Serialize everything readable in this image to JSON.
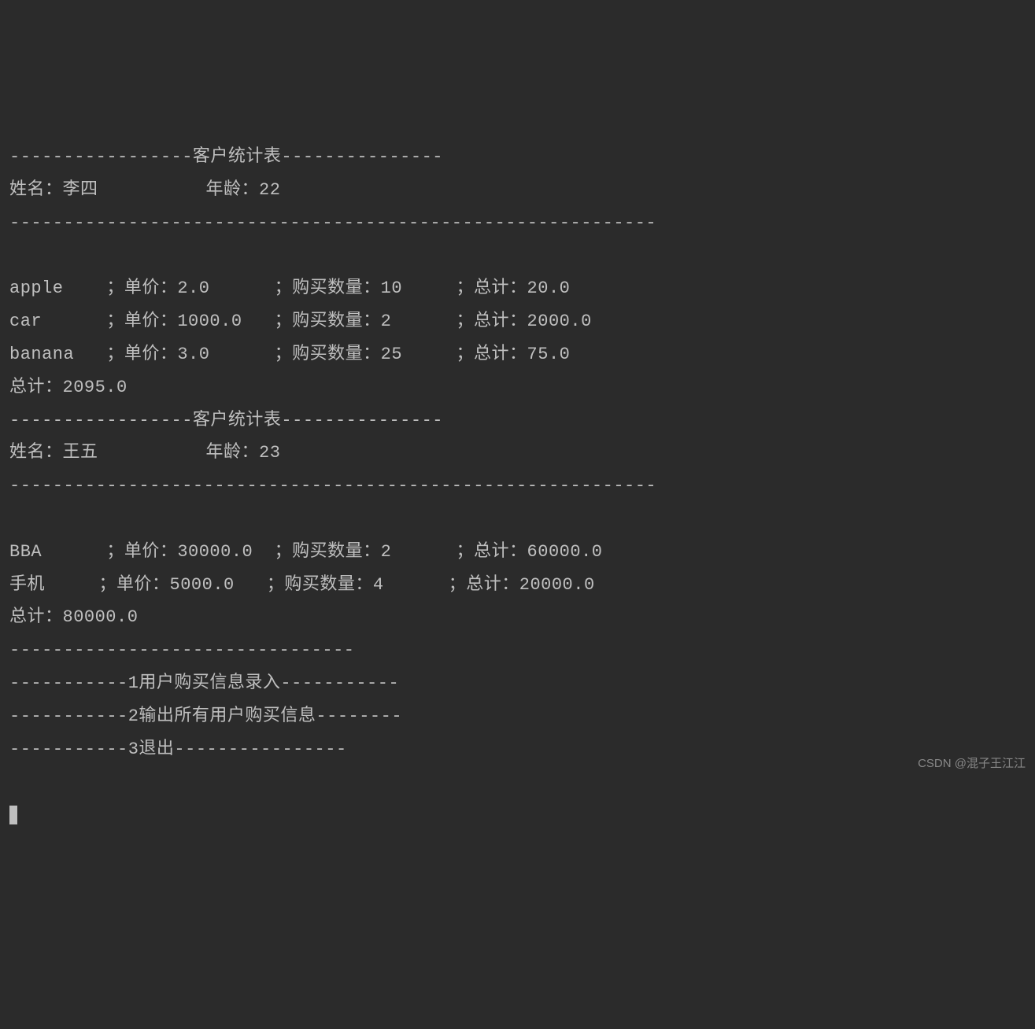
{
  "customers": [
    {
      "header": "-----------------客户统计表---------------",
      "name_label": "姓名：",
      "name": "李四",
      "age_label": "年龄：",
      "age": "22",
      "divider": "------------------------------------------------------------",
      "items": [
        {
          "name": "apple",
          "price_label": "；单价：",
          "price": "2.0",
          "qty_label": "；购买数量：",
          "qty": "10",
          "total_label": "；总计：",
          "total": "20.0"
        },
        {
          "name": "car",
          "price_label": "；单价：",
          "price": "1000.0",
          "qty_label": "；购买数量：",
          "qty": "2",
          "total_label": "；总计：",
          "total": "2000.0"
        },
        {
          "name": "banana",
          "price_label": "；单价：",
          "price": "3.0",
          "qty_label": "；购买数量：",
          "qty": "25",
          "total_label": "；总计：",
          "total": "75.0"
        }
      ],
      "sum_label": "总计：",
      "sum": "2095.0"
    },
    {
      "header": "-----------------客户统计表---------------",
      "name_label": "姓名：",
      "name": "王五",
      "age_label": "年龄：",
      "age": "23",
      "divider": "------------------------------------------------------------",
      "items": [
        {
          "name": "BBA",
          "price_label": "；单价：",
          "price": "30000.0",
          "qty_label": "；购买数量：",
          "qty": "2",
          "total_label": "；总计：",
          "total": "60000.0"
        },
        {
          "name": "手机",
          "price_label": "；单价：",
          "price": "5000.0",
          "qty_label": "；购买数量：",
          "qty": "4",
          "total_label": "；总计：",
          "total": "20000.0"
        }
      ],
      "sum_label": "总计：",
      "sum": "80000.0"
    }
  ],
  "menu": {
    "divider": "--------------------------------",
    "option1": "-----------1用户购买信息录入-----------",
    "option2": "-----------2输出所有用户购买信息--------",
    "option3": "-----------3退出----------------"
  },
  "watermark": "CSDN @混子王江江"
}
